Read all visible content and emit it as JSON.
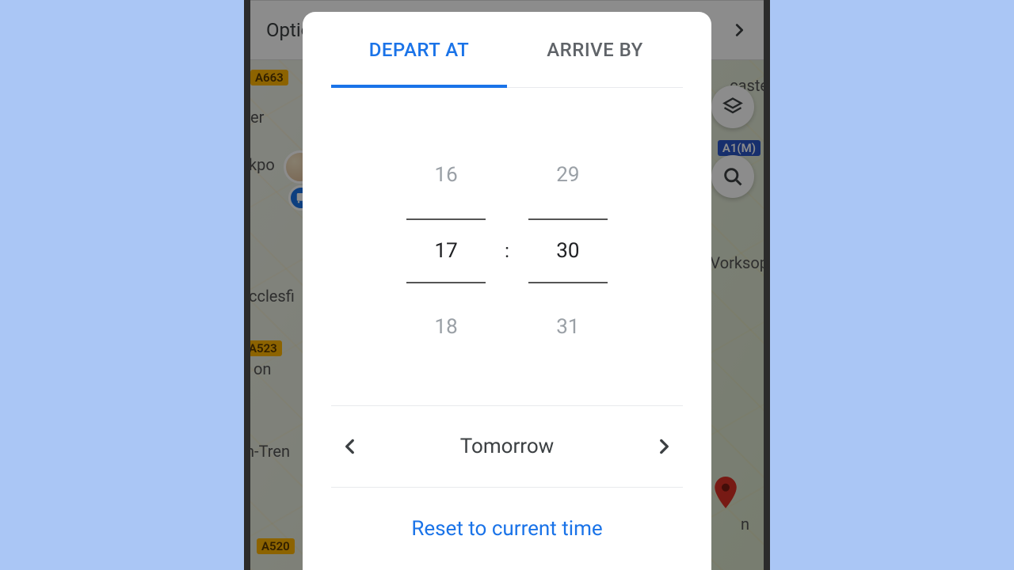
{
  "background": {
    "options_bar_label": "Options",
    "road_labels": {
      "a663": "A663",
      "a523": "A523",
      "a520": "A520",
      "a1m": "A1(M)"
    },
    "city_labels": {
      "er": "er",
      "kpo": "kpo",
      "cclesfi": "cclesfi",
      "on": "on",
      "n_tren": "n-Tren",
      "caste": "caste",
      "vorksop": "Vorksop",
      "n2": "n"
    }
  },
  "dialog": {
    "tabs": {
      "depart": "DEPART AT",
      "arrive": "ARRIVE BY",
      "active": "depart"
    },
    "time": {
      "hour_prev": "16",
      "hour_sel": "17",
      "hour_next": "18",
      "min_prev": "29",
      "min_sel": "30",
      "min_next": "31",
      "separator": ":"
    },
    "date": {
      "label": "Tomorrow"
    },
    "reset_label": "Reset to current time"
  }
}
